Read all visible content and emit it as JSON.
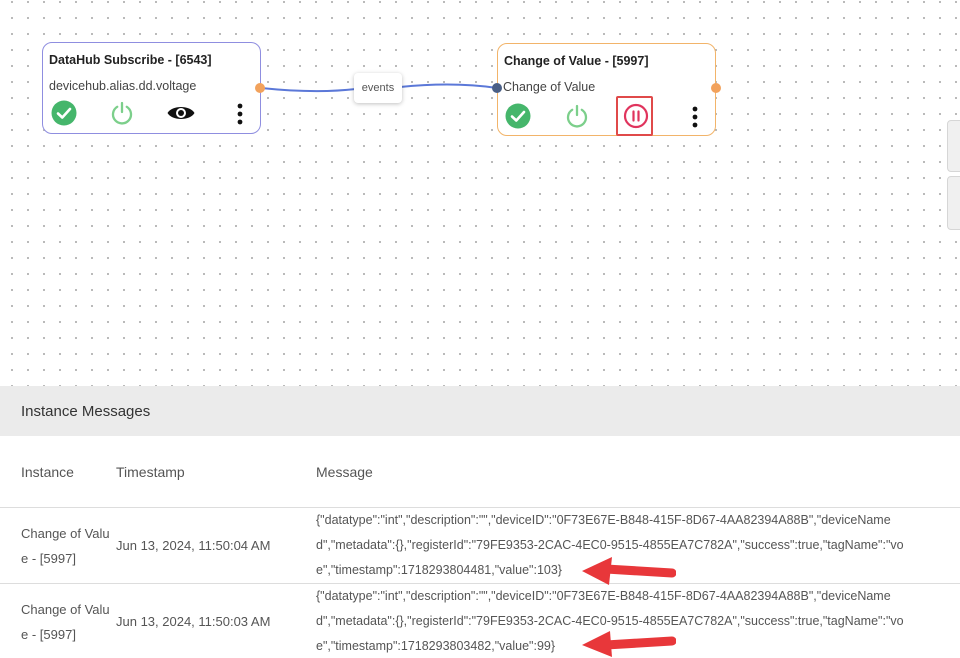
{
  "nodes": [
    {
      "title": "DataHub Subscribe - [6543]",
      "subtitle": "devicehub.alias.dd.voltage",
      "border_color": "#8f8ee0",
      "icons": [
        "check-circle-icon",
        "power-icon",
        "eye-icon",
        "more-vertical-icon"
      ]
    },
    {
      "title": "Change of Value - [5997]",
      "subtitle": "Change of Value",
      "border_color": "#f2b46a",
      "icons": [
        "check-circle-icon",
        "power-icon",
        "pause-circle-icon",
        "more-vertical-icon"
      ]
    }
  ],
  "edge": {
    "label": "events",
    "color": "#5b78d8"
  },
  "colors": {
    "success": "#45b66b",
    "power": "#7ccf8b",
    "pause": "#e0345d",
    "highlight": "#e04a4a",
    "output_port": "#f2a25c"
  },
  "messages_panel": {
    "title": "Instance Messages",
    "columns": {
      "instance": "Instance",
      "timestamp": "Timestamp",
      "message": "Message"
    },
    "rows": [
      {
        "instance": "Change of Value - [5997]",
        "timestamp": "Jun 13, 2024, 11:50:04 AM",
        "message_lines": [
          "{\"datatype\":\"int\",\"description\":\"\",\"deviceID\":\"0F73E67E-B848-415F-8D67-4AA82394A88B\",\"deviceName",
          "d\",\"metadata\":{},\"registerId\":\"79FE9353-2CAC-4EC0-9515-4855EA7C782A\",\"success\":true,\"tagName\":\"vo",
          "e\",\"timestamp\":1718293804481,\"value\":103}"
        ]
      },
      {
        "instance": "Change of Value - [5997]",
        "timestamp": "Jun 13, 2024, 11:50:03 AM",
        "message_lines": [
          "{\"datatype\":\"int\",\"description\":\"\",\"deviceID\":\"0F73E67E-B848-415F-8D67-4AA82394A88B\",\"deviceName",
          "d\",\"metadata\":{},\"registerId\":\"79FE9353-2CAC-4EC0-9515-4855EA7C782A\",\"success\":true,\"tagName\":\"vo",
          "e\",\"timestamp\":1718293803482,\"value\":99}"
        ]
      }
    ]
  }
}
